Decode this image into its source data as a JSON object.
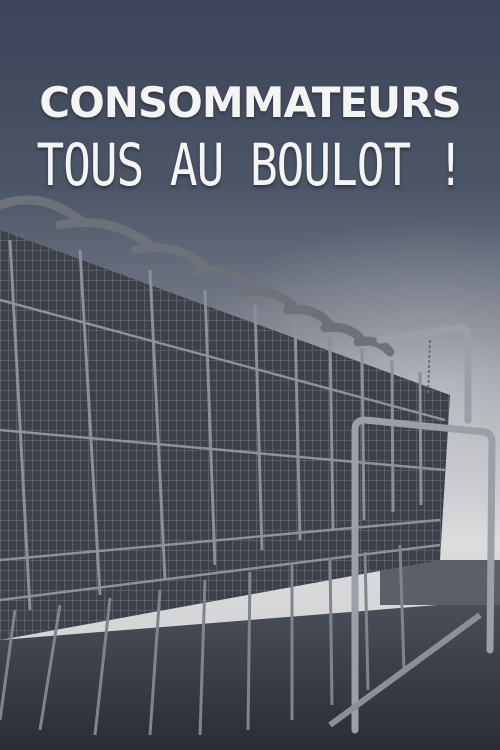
{
  "poster": {
    "title_line1": "CONSOMMATEURS",
    "title_line2": "TOUS AU BOULOT !",
    "image_subject": "shopping-carts",
    "colors": {
      "background_dark": "#3b4458",
      "background_light": "#d9dadc",
      "title_text": "#f4f4f4",
      "metal": "#5e636c"
    }
  }
}
